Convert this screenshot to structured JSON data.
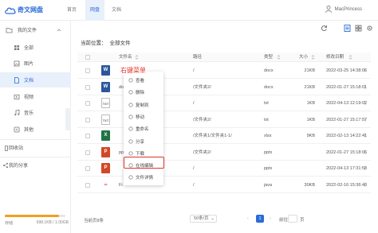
{
  "app": {
    "title": "奇文网盘"
  },
  "nav": [
    {
      "label": "首页",
      "active": false
    },
    {
      "label": "网盘",
      "active": true
    },
    {
      "label": "文档",
      "active": false
    }
  ],
  "user": {
    "name": "MacPrincess"
  },
  "sidebar": {
    "my_files": "我的文件",
    "items": [
      {
        "label": "全部",
        "icon": "grid-icon"
      },
      {
        "label": "图片",
        "icon": "image-icon"
      },
      {
        "label": "文档",
        "icon": "document-icon",
        "active": true
      },
      {
        "label": "视频",
        "icon": "video-icon"
      },
      {
        "label": "音乐",
        "icon": "music-icon"
      },
      {
        "label": "其他",
        "icon": "other-icon"
      }
    ],
    "recycle": "回收站",
    "share": "我的分享",
    "storage_label": "存储",
    "storage_used": "698.1KB / 1.00GB",
    "storage_fraction": 0.9
  },
  "breadcrumb": {
    "label": "当前位置：",
    "root": "全部文件"
  },
  "table": {
    "headers": {
      "name": "文件名",
      "path": "路径",
      "type": "类型",
      "size": "大小",
      "modified": "修改日期"
    },
    "rows": [
      {
        "icon": "word",
        "name": "",
        "path": "/",
        "type": "docx",
        "size": "21KB",
        "date": "2022-03-25 14:38:06"
      },
      {
        "icon": "word",
        "name": "docx",
        "path": "/文件夹2/",
        "type": "docx",
        "size": "21KB",
        "date": "2022-01-27 15:18:01"
      },
      {
        "icon": "txt",
        "name": "",
        "path": "/",
        "type": "txt",
        "size": "1KB",
        "date": "2022-04-13 12:19:02"
      },
      {
        "icon": "txt",
        "name": "",
        "path": "/文件夹2/",
        "type": "txt",
        "size": "1KB",
        "date": "2022-01-27 15:17:57"
      },
      {
        "icon": "xls",
        "name": "",
        "path": "/文件夹1/文件夹1-1/",
        "type": "xlsx",
        "size": "9KB",
        "date": "2022-02-13 14:22:41"
      },
      {
        "icon": "ppt",
        "name": "pptx",
        "path": "/文件夹2/",
        "type": "pptx",
        "size": "",
        "date": "2022-01-27 15:18:06"
      },
      {
        "icon": "ppt",
        "name": "",
        "path": "/",
        "type": "pptx",
        "size": "",
        "date": "2022-04-13 17:31:58"
      },
      {
        "icon": "java",
        "name": "Fi",
        "path": "/",
        "type": "java",
        "size": "30KB",
        "date": "2022-02-16 15:36:40"
      }
    ]
  },
  "context_menu": {
    "title": "右键菜单",
    "items": [
      {
        "label": "查看",
        "icon": "eye-icon"
      },
      {
        "label": "删除",
        "icon": "trash-icon"
      },
      {
        "label": "复制到",
        "icon": "copy-icon"
      },
      {
        "label": "移动",
        "icon": "move-icon"
      },
      {
        "label": "重命名",
        "icon": "rename-icon"
      },
      {
        "label": "分享",
        "icon": "share-icon"
      },
      {
        "label": "下载",
        "icon": "download-icon"
      },
      {
        "label": "在线编辑",
        "icon": "edit-icon",
        "highlighted": true
      },
      {
        "label": "文件详情",
        "icon": "info-icon"
      }
    ]
  },
  "pagination": {
    "total": "当前页8条",
    "page_size": "50条/页",
    "current": "1",
    "goto_label": "前往",
    "page_unit": "页"
  },
  "colors": {
    "brand": "#2b6cd8",
    "accent": "#e0352b"
  }
}
